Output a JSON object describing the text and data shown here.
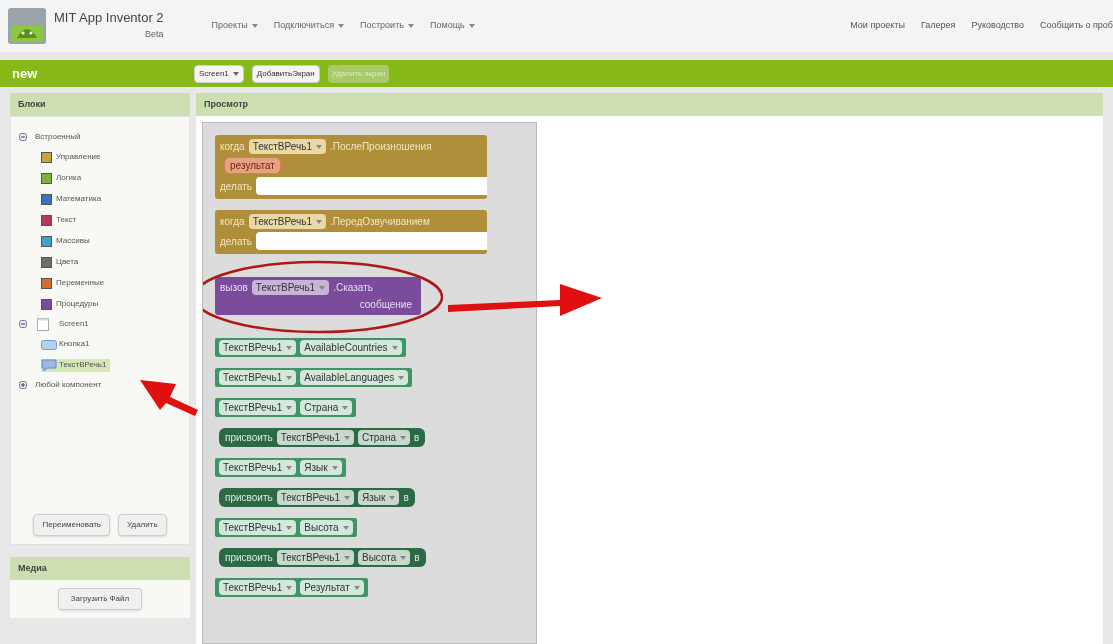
{
  "header": {
    "app_name": "MIT App Inventor 2",
    "edition": "Beta",
    "menus": [
      {
        "label": "Проекты"
      },
      {
        "label": "Подключиться"
      },
      {
        "label": "Построить"
      },
      {
        "label": "Помощь"
      }
    ],
    "links": [
      "Мои проекты",
      "Галерея",
      "Руководство",
      "Сообщить о проб"
    ]
  },
  "toolbar": {
    "project": "new",
    "buttons": [
      {
        "label": "Screen1",
        "dropdown": true,
        "disabled": false
      },
      {
        "label": "ДобавитьЭкран",
        "dropdown": false,
        "disabled": false
      },
      {
        "label": "Удалить экран",
        "dropdown": false,
        "disabled": true
      }
    ]
  },
  "blocks_panel": {
    "title": "Блоки",
    "tree": [
      {
        "label": "Встроенный",
        "kind": "group",
        "expanded": true,
        "children": [
          {
            "label": "Управление",
            "color": "#c8a33b",
            "selected": false
          },
          {
            "label": "Логика",
            "color": "#7fb23c",
            "selected": false
          },
          {
            "label": "Математика",
            "color": "#3f6fbf",
            "selected": false
          },
          {
            "label": "Текст",
            "color": "#b5385a",
            "selected": false
          },
          {
            "label": "Массивы",
            "color": "#3ea3c8",
            "selected": false
          },
          {
            "label": "Цвета",
            "color": "#6d6d6d",
            "selected": false
          },
          {
            "label": "Переменные",
            "color": "#d9692c",
            "selected": false
          },
          {
            "label": "Процедуры",
            "color": "#7a4c9a",
            "selected": false
          }
        ]
      },
      {
        "label": "Screen1",
        "kind": "screen",
        "expanded": true,
        "children": [
          {
            "label": "Кнопка1",
            "kind": "button",
            "selected": false
          },
          {
            "label": "ТекстВРечь1",
            "kind": "speech",
            "selected": true
          }
        ]
      },
      {
        "label": "Любой компонент",
        "kind": "group",
        "expanded": false
      }
    ],
    "buttons": [
      "Переименовать",
      "Удалить"
    ]
  },
  "media_panel": {
    "title": "Медиа",
    "button": "Загрузить Файл"
  },
  "viewer": {
    "title": "Просмотр",
    "blocks": [
      {
        "kind": "event",
        "keyword": "когда",
        "component": "ТекстВРечь1",
        "name": ".ПослеПроизношения",
        "param": "результат",
        "do": "делать"
      },
      {
        "kind": "event",
        "keyword": "когда",
        "component": "ТекстВРечь1",
        "name": ".ПередОзвучиванием",
        "do": "делать"
      },
      {
        "kind": "call",
        "keyword": "вызов",
        "component": "ТекстВРечь1",
        "name": ".Сказать",
        "arg": "сообщение"
      },
      {
        "kind": "getter",
        "component": "ТекстВРечь1",
        "property": "AvailableCountries"
      },
      {
        "kind": "getter",
        "component": "ТекстВРечь1",
        "property": "AvailableLanguages"
      },
      {
        "kind": "getter",
        "component": "ТекстВРечь1",
        "property": "Страна"
      },
      {
        "kind": "setter",
        "keyword": "присвоить",
        "component": "ТекстВРечь1",
        "property": "Страна",
        "to": "в"
      },
      {
        "kind": "getter",
        "component": "ТекстВРечь1",
        "property": "Язык"
      },
      {
        "kind": "setter",
        "keyword": "присвоить",
        "component": "ТекстВРечь1",
        "property": "Язык",
        "to": "в"
      },
      {
        "kind": "getter",
        "component": "ТекстВРечь1",
        "property": "Высота"
      },
      {
        "kind": "setter",
        "keyword": "присвоить",
        "component": "ТекстВРечь1",
        "property": "Высота",
        "to": "в"
      },
      {
        "kind": "getter",
        "component": "ТекстВРечь1",
        "property": "Результат"
      }
    ]
  }
}
